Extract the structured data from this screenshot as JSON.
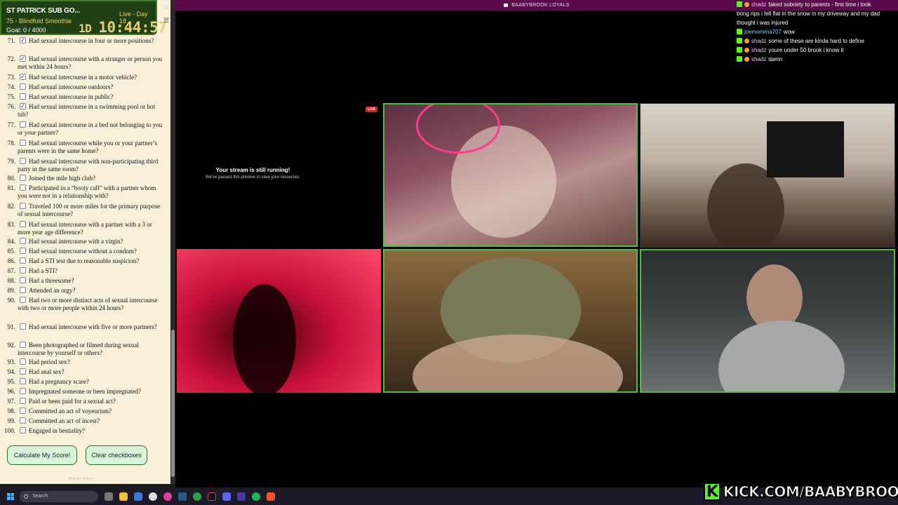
{
  "topbar": {
    "title": "BAABYBROOK LOYALS"
  },
  "widget": {
    "title": "ST PATRICK SUB GO...",
    "subtitle": "75 - Blindfold Smoothie",
    "goal": "Goal: 0 / 4000",
    "live_day": "Live - Day 18",
    "days": "1D",
    "time": "10:44:57"
  },
  "checklist": [
    {
      "num": "71.",
      "text": "Had sexual intercourse in four or more positions?",
      "checked": true
    },
    {
      "num": "72.",
      "text": "Had sexual intercourse with a stranger or person you met within 24 hours?",
      "checked": true
    },
    {
      "num": "73.",
      "text": "Had sexual intercourse in a motor vehicle?",
      "checked": true
    },
    {
      "num": "74.",
      "text": "Had sexual intercourse outdoors?",
      "checked": false
    },
    {
      "num": "75.",
      "text": "Had sexual intercourse in public?",
      "checked": false
    },
    {
      "num": "76.",
      "text": "Had sexual intercourse in a swimming pool or hot tub?",
      "checked": true
    },
    {
      "num": "77.",
      "text": "Had sexual intercourse in a bed not belonging to you or your partner?",
      "checked": false
    },
    {
      "num": "78.",
      "text": "Had sexual intercourse while you or your partner’s parents were in the same home?",
      "checked": false
    },
    {
      "num": "79.",
      "text": "Had sexual intercourse with non-participating third party in the same room?",
      "checked": false
    },
    {
      "num": "80.",
      "text": "Joined the mile high club?",
      "checked": false
    },
    {
      "num": "81.",
      "text": "Participated in a “booty call” with a partner whom you were not in a relationship with?",
      "checked": false
    },
    {
      "num": "82.",
      "text": "Traveled 100 or more miles for the primary purpose of sexual intercourse?",
      "checked": false
    },
    {
      "num": "83.",
      "text": "Had sexual intercourse with a partner with a 3 or more year age difference?",
      "checked": false
    },
    {
      "num": "84.",
      "text": "Had sexual intercourse with a virgin?",
      "checked": false
    },
    {
      "num": "85.",
      "text": "Had sexual intercourse without a condom?",
      "checked": false
    },
    {
      "num": "86.",
      "text": "Had a STI test due to reasonable suspicion?",
      "checked": false
    },
    {
      "num": "87.",
      "text": "Had a STI?",
      "checked": false
    },
    {
      "num": "88.",
      "text": "Had a threesome?",
      "checked": false
    },
    {
      "num": "89.",
      "text": "Attended an orgy?",
      "checked": false
    },
    {
      "num": "90.",
      "text": "Had two or more distinct acts of sexual intercourse with two or more people within 24 hours?",
      "checked": false
    },
    {
      "num": "91.",
      "text": "Had sexual intercourse with five or more partners?",
      "checked": false
    },
    {
      "num": "92.",
      "text": "Been photographed or filmed during sexual intercourse by yourself or others?",
      "checked": false
    },
    {
      "num": "93.",
      "text": "Had period sex?",
      "checked": false
    },
    {
      "num": "94.",
      "text": "Had anal sex?",
      "checked": false
    },
    {
      "num": "95.",
      "text": "Had a pregnancy scare?",
      "checked": false
    },
    {
      "num": "96.",
      "text": "Impregnated someone or been impregnated?",
      "checked": false
    },
    {
      "num": "97.",
      "text": "Paid or been paid for a sexual act?",
      "checked": false
    },
    {
      "num": "98.",
      "text": "Committed an act of voyeurism?",
      "checked": false
    },
    {
      "num": "99.",
      "text": "Committed an act of incest?",
      "checked": false
    },
    {
      "num": "100.",
      "text": "Engaged in bestiality?",
      "checked": false
    }
  ],
  "buttons": {
    "calculate": "Calculate My Score!",
    "clear": "Clear checkboxes"
  },
  "privacy": "Privacy Policy",
  "stream": {
    "paused_title": "Your stream is still running!",
    "paused_sub": "We've paused this preview to save your resources.",
    "live_badge": "LIVE"
  },
  "chat": [
    {
      "user": "shadz",
      "text": "faked sobriety to parents - first time i took",
      "kick": true,
      "emote": true
    },
    {
      "user": "",
      "text": "bong rips i fell flat in the snow in my driveway and my dad",
      "kick": false,
      "emote": false
    },
    {
      "user": "",
      "text": "thought i was injured",
      "kick": false,
      "emote": false
    },
    {
      "user": "joemomma707",
      "text": "wow",
      "kick": true,
      "emote": false
    },
    {
      "user": "shadz",
      "text": "some of these are kinda hard to define",
      "kick": true,
      "emote": true
    },
    {
      "user": "shadz",
      "text": "youre under 50 brook i know it",
      "kick": true,
      "emote": true
    },
    {
      "user": "shadz",
      "text": "damn",
      "kick": true,
      "emote": true
    }
  ],
  "taskbar": {
    "search": "Search"
  },
  "watermark": {
    "text": "KICK.COM/BAABYBROOK"
  },
  "colors": {
    "kick_green": "#53fc18",
    "widget_bg": "#1f3f14",
    "paper": "#f8f0d8",
    "topbar": "#5a0a4a"
  }
}
